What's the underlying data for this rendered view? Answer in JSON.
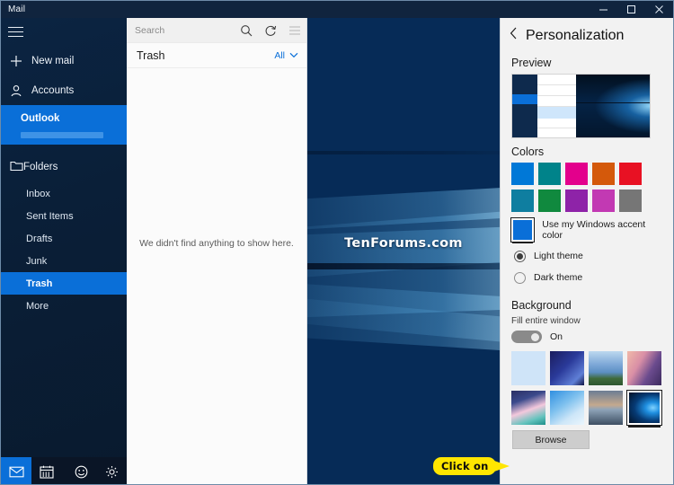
{
  "window": {
    "title": "Mail",
    "controls": [
      {
        "name": "minimize",
        "glyph": "minimize-icon"
      },
      {
        "name": "maximize",
        "glyph": "maximize-icon"
      },
      {
        "name": "close",
        "glyph": "close-icon"
      }
    ]
  },
  "leftnav": {
    "hamburger_label": "hamburger-menu",
    "new_mail": "New mail",
    "accounts": "Accounts",
    "account_name": "Outlook",
    "folders_label": "Folders",
    "folders": [
      {
        "label": "Inbox",
        "selected": false
      },
      {
        "label": "Sent Items",
        "selected": false
      },
      {
        "label": "Drafts",
        "selected": false
      },
      {
        "label": "Junk",
        "selected": false
      },
      {
        "label": "Trash",
        "selected": true
      },
      {
        "label": "More",
        "selected": false
      }
    ],
    "bottom_bar": [
      {
        "name": "mail-icon",
        "active": true
      },
      {
        "name": "calendar-icon",
        "active": false
      },
      {
        "name": "feedback-icon",
        "active": false
      },
      {
        "name": "settings-gear-icon",
        "active": false
      }
    ]
  },
  "list": {
    "search_placeholder": "Search",
    "search_icon": "search-icon",
    "sync_icon": "sync-icon",
    "selectmode_icon": "selection-mode-icon",
    "folder_name": "Trash",
    "filter_value": "All",
    "filter_chevron": "chevron-down-icon",
    "empty_message": "We didn't find anything to show here."
  },
  "reading_pane": {
    "watermark": "TenForums.com"
  },
  "settings": {
    "back_icon": "chevron-left-icon",
    "title": "Personalization",
    "preview_label": "Preview",
    "colors_label": "Colors",
    "colors_row1": [
      "#0078d7",
      "#00838a",
      "#e3008c",
      "#d4590b",
      "#e81123"
    ],
    "colors_row2": [
      "#0f7ea0",
      "#10893e",
      "#8e23a8",
      "#c239b3",
      "#767676"
    ],
    "accent_swatch_color": "#0a6fd8",
    "accent_label": "Use my Windows accent color",
    "themes": [
      {
        "label": "Light theme",
        "selected": true
      },
      {
        "label": "Dark theme",
        "selected": false
      }
    ],
    "background_label": "Background",
    "fill_label": "Fill entire window",
    "toggle_state": "On",
    "thumbnails_row1": [
      {
        "name": "plain-light-blue",
        "selected": false
      },
      {
        "name": "dark-streaks",
        "selected": false
      },
      {
        "name": "blue-hill",
        "selected": false
      },
      {
        "name": "pink-ribbon",
        "selected": false
      }
    ],
    "thumbnails_row2": [
      {
        "name": "pastel-waves",
        "selected": false
      },
      {
        "name": "blue-polygons",
        "selected": false
      },
      {
        "name": "lake-sunset",
        "selected": false
      },
      {
        "name": "windows-hero",
        "selected": true
      }
    ],
    "browse_label": "Browse"
  },
  "callout": {
    "text": "Click on"
  }
}
